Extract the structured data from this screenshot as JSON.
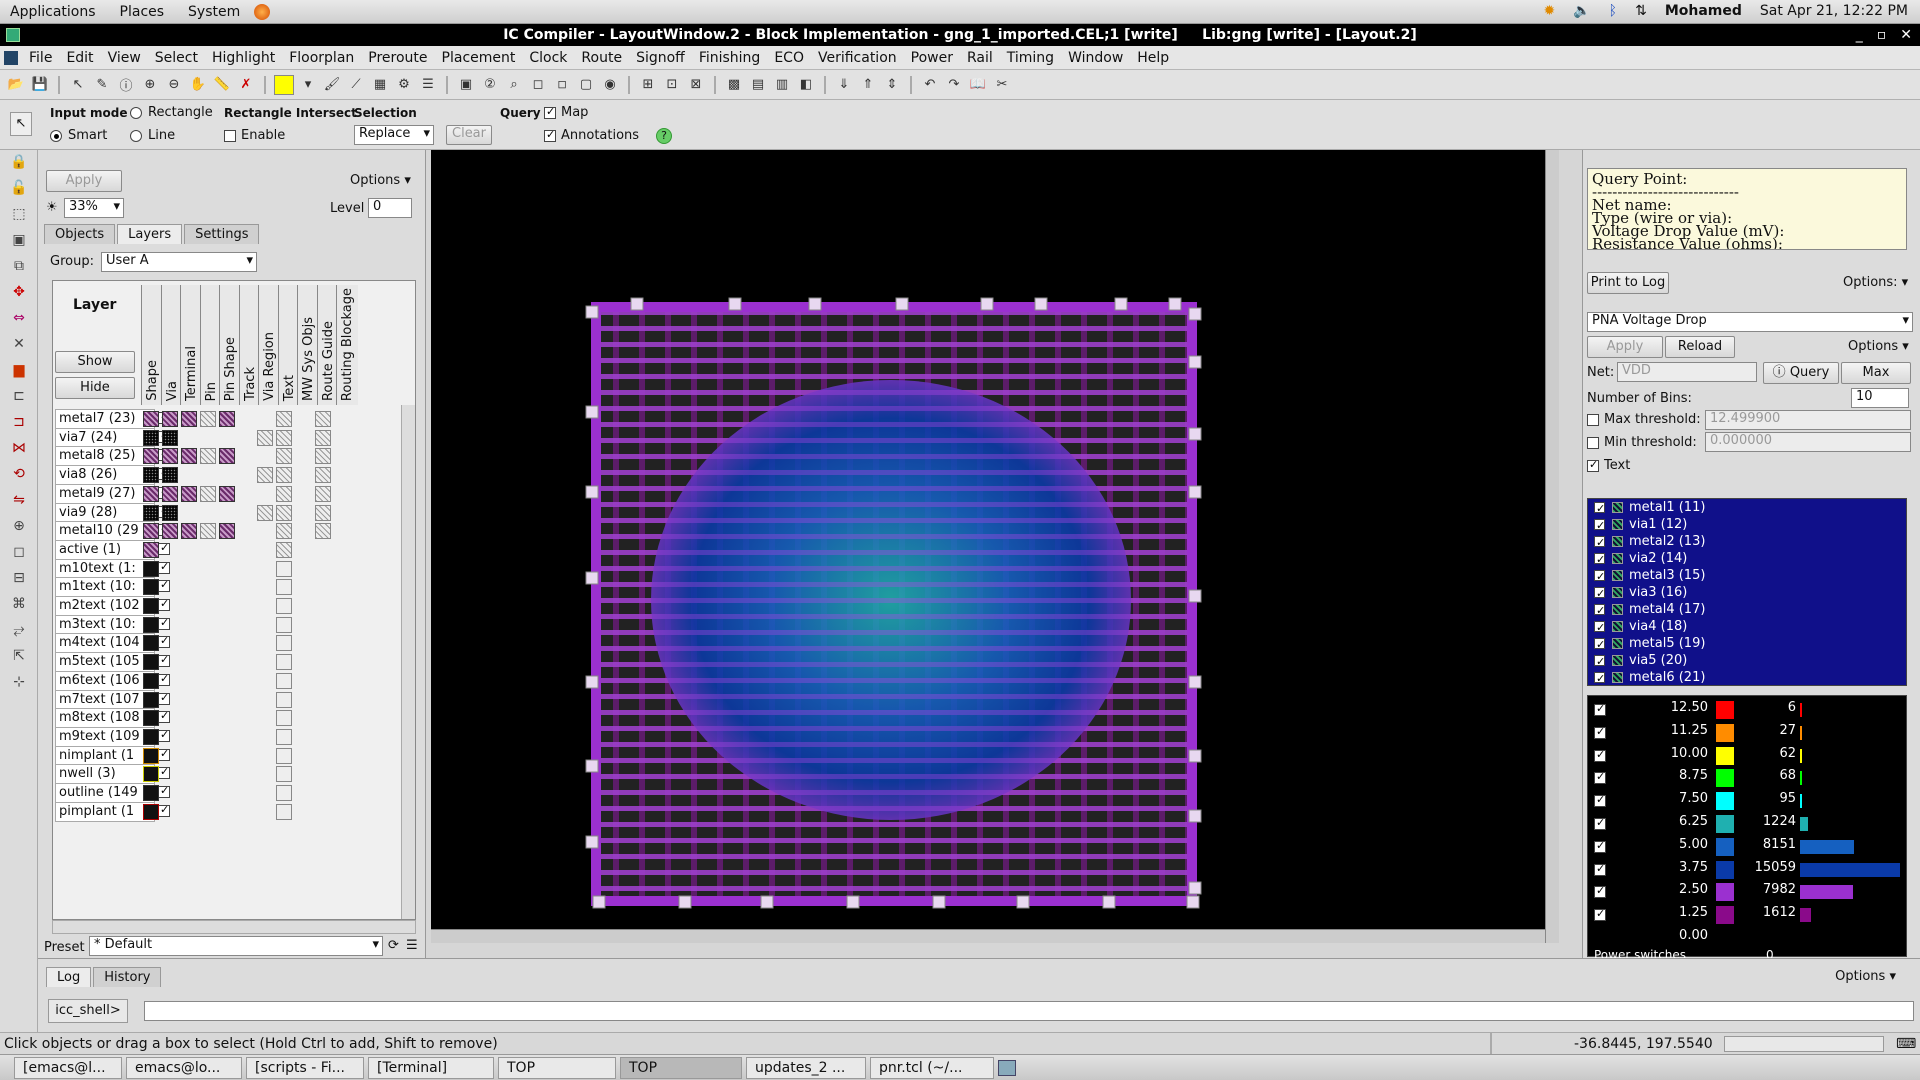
{
  "gnome": {
    "applications": "Applications",
    "places": "Places",
    "system": "System",
    "user": "Mohamed",
    "datetime": "Sat Apr 21, 12:22 PM"
  },
  "window": {
    "title": "IC Compiler - LayoutWindow.2 - Block Implementation - gng_1_imported.CEL;1 [write]     Lib:gng [write] - [Layout.2]"
  },
  "menubar": [
    "File",
    "Edit",
    "View",
    "Select",
    "Highlight",
    "Floorplan",
    "Preroute",
    "Placement",
    "Clock",
    "Route",
    "Signoff",
    "Finishing",
    "ECO",
    "Verification",
    "Power",
    "Rail",
    "Timing",
    "Window",
    "Help"
  ],
  "optbar": {
    "input_mode_label": "Input mode",
    "rectangle": "Rectangle",
    "smart": "Smart",
    "line": "Line",
    "rect_intersect_label": "Rectangle Intersect",
    "enable": "Enable",
    "selection_label": "Selection",
    "selection_value": "Replace",
    "clear": "Clear",
    "query_label": "Query",
    "map": "Map",
    "annotations": "Annotations"
  },
  "layers_panel": {
    "apply": "Apply",
    "options": "Options",
    "zoom": "33%",
    "level_label": "Level",
    "level_value": "0",
    "tabs": [
      "Objects",
      "Layers",
      "Settings"
    ],
    "group_label": "Group:",
    "group_value": "User A",
    "layer_header": "Layer",
    "show": "Show",
    "hide": "Hide",
    "columns": [
      "Shape",
      "Via",
      "Terminal",
      "Pin",
      "Pin Shape",
      "Track",
      "Via Region",
      "Text",
      "MW Sys Objs",
      "Route Guide",
      "Routing Blockage"
    ],
    "rows": [
      {
        "name": "metal7 (23)",
        "kind": "metal"
      },
      {
        "name": "via7 (24)",
        "kind": "via"
      },
      {
        "name": "metal8 (25)",
        "kind": "metal"
      },
      {
        "name": "via8 (26)",
        "kind": "via"
      },
      {
        "name": "metal9 (27)",
        "kind": "metal"
      },
      {
        "name": "via9 (28)",
        "kind": "via"
      },
      {
        "name": "metal10 (29",
        "kind": "metal"
      },
      {
        "name": "active (1)",
        "kind": "active"
      },
      {
        "name": "m10text (1:",
        "kind": "text"
      },
      {
        "name": "m1text (10:",
        "kind": "text"
      },
      {
        "name": "m2text (102",
        "kind": "text"
      },
      {
        "name": "m3text (10:",
        "kind": "text"
      },
      {
        "name": "m4text (104",
        "kind": "text"
      },
      {
        "name": "m5text (105",
        "kind": "text"
      },
      {
        "name": "m6text (106",
        "kind": "text"
      },
      {
        "name": "m7text (107",
        "kind": "text"
      },
      {
        "name": "m8text (108",
        "kind": "text"
      },
      {
        "name": "m9text (109",
        "kind": "text"
      },
      {
        "name": "nimplant (1",
        "kind": "nimplant"
      },
      {
        "name": "nwell (3)",
        "kind": "nwell"
      },
      {
        "name": "outline (149",
        "kind": "text"
      },
      {
        "name": "pimplant (1",
        "kind": "pimplant"
      }
    ],
    "preset_label": "Preset",
    "preset_value": "* Default"
  },
  "right_panel": {
    "query_lines": [
      "Query Point:",
      "-----------------------------",
      "Net name:",
      "Type (wire or via):",
      "Voltage Drop Value (mV):",
      "Resistance Value (ohms):"
    ],
    "print_to_log": "Print to Log",
    "options": "Options:",
    "map_select": "PNA Voltage Drop",
    "apply": "Apply",
    "reload": "Reload",
    "options2": "Options",
    "net_label": "Net:",
    "net_value": "VDD",
    "query_btn": "Query",
    "max_btn": "Max",
    "bins_label": "Number of Bins:",
    "bins_value": "10",
    "max_thr_label": "Max threshold:",
    "max_thr_value": "12.499900",
    "min_thr_label": "Min threshold:",
    "min_thr_value": "0.000000",
    "text_label": "Text",
    "metal_layers": [
      "metal1 (11)",
      "via1 (12)",
      "metal2 (13)",
      "via2 (14)",
      "metal3 (15)",
      "via3 (16)",
      "metal4 (17)",
      "via4 (18)",
      "metal5 (19)",
      "via5 (20)",
      "metal6 (21)"
    ],
    "histogram": [
      {
        "thr": "12.50",
        "color": "#ff0000",
        "count": "6",
        "frac": 0.0004
      },
      {
        "thr": "11.25",
        "color": "#ff8c00",
        "count": "27",
        "frac": 0.0018
      },
      {
        "thr": "10.00",
        "color": "#ffff00",
        "count": "62",
        "frac": 0.004
      },
      {
        "thr": "8.75",
        "color": "#00ff00",
        "count": "68",
        "frac": 0.0045
      },
      {
        "thr": "7.50",
        "color": "#00ffff",
        "count": "95",
        "frac": 0.0063
      },
      {
        "thr": "6.25",
        "color": "#1fb0b0",
        "count": "1224",
        "frac": 0.081
      },
      {
        "thr": "5.00",
        "color": "#1560c0",
        "count": "8151",
        "frac": 0.54
      },
      {
        "thr": "3.75",
        "color": "#0a3aa8",
        "count": "15059",
        "frac": 1.0
      },
      {
        "thr": "2.50",
        "color": "#9b30d0",
        "count": "7982",
        "frac": 0.53
      },
      {
        "thr": "1.25",
        "color": "#8a0a8a",
        "count": "1612",
        "frac": 0.107
      },
      {
        "thr": "0.00",
        "color": "",
        "count": "",
        "frac": 0
      }
    ],
    "power_switches": "Power switches",
    "power_switches_count": "0"
  },
  "log": {
    "tabs": [
      "Log",
      "History"
    ],
    "options": "Options",
    "prompt": "icc_shell>"
  },
  "status": {
    "message": "Click objects or drag a box to select (Hold Ctrl to add, Shift to remove)",
    "coords": "-36.8445, 197.5540"
  },
  "taskbar": [
    "[emacs@l...",
    "emacs@lo...",
    "[scripts - Fi...",
    "[Terminal]",
    "TOP",
    "TOP",
    "updates_2 ...",
    "pnr.tcl (~/..."
  ]
}
